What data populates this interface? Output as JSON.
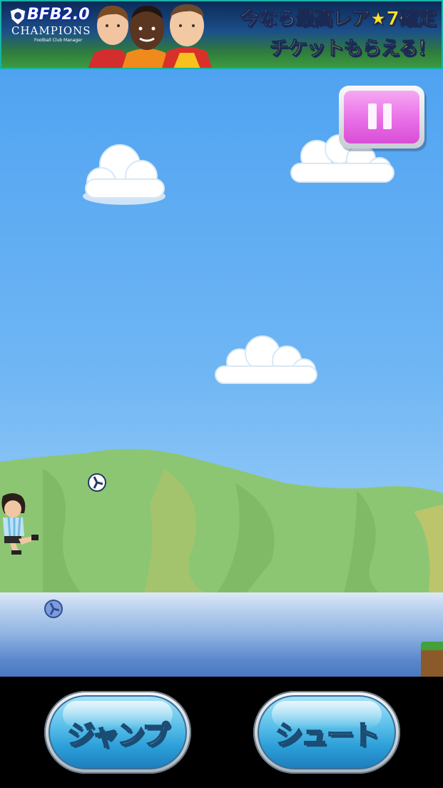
{
  "banner": {
    "logo_main": "BFB2.0",
    "logo_sub": "CHAMPIONS",
    "logo_small": "Football Club Manager",
    "tagline_line1_a": "今なら",
    "tagline_line1_b": "最高レア★7確定",
    "tagline_line2_a": "チケット",
    "tagline_line2_b": "もらえる！"
  },
  "controls": {
    "jump_label": "ジャンプ",
    "shoot_label": "シュート"
  },
  "colors": {
    "sky": "#50a3f1",
    "hill": "#86c26b",
    "pause": "#e96fe7",
    "button": "#2c9fd8"
  },
  "icons": {
    "pause": "pause-icon",
    "ball": "soccer-ball-icon"
  }
}
